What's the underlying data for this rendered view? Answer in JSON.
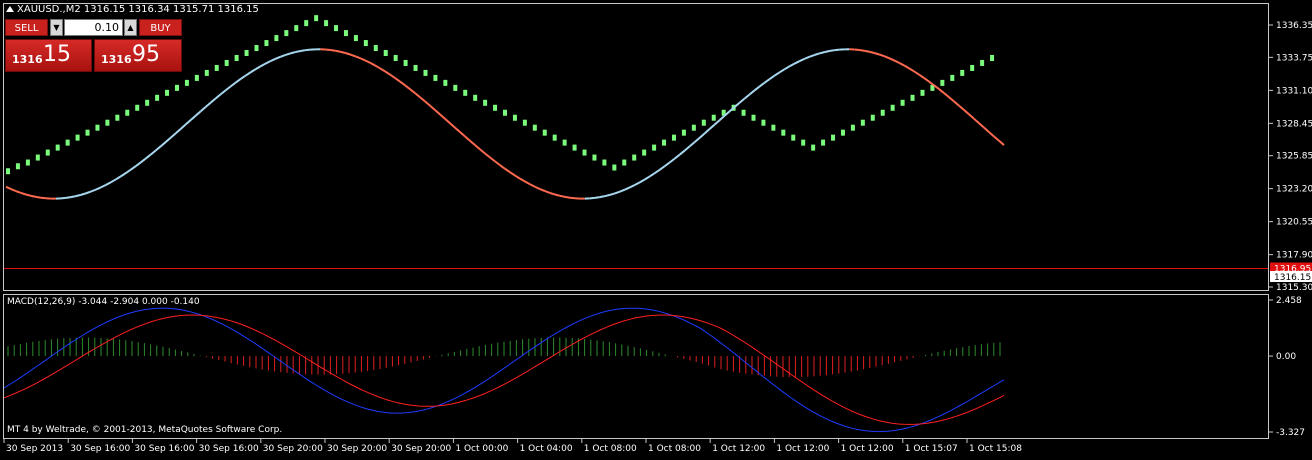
{
  "header": {
    "symbol_line": "XAUUSD.,M2  1316.15 1316.34 1315.71 1316.15",
    "collapse_icon": "triangle-up-icon"
  },
  "trade_panel": {
    "sell_label": "SELL",
    "buy_label": "BUY",
    "lot_value": "0.10",
    "sell_price_big": "1316",
    "sell_price_pips": "15",
    "buy_price_big": "1316",
    "buy_price_pips": "95",
    "colors": {
      "button_red": "#c9211e"
    }
  },
  "indicator": {
    "label": "MACD(12,26,9) -3.044 -2.904 0.000 -0.140"
  },
  "footer": {
    "copyright": "MT 4 by Weltrade, © 2001-2013, MetaQuotes Software Corp."
  },
  "chart_data": [
    {
      "type": "line",
      "title": "XAUUSD.,M2",
      "price_axis_ticks": [
        "1336.35",
        "1333.75",
        "1331.10",
        "1328.45",
        "1325.85",
        "1323.20",
        "1320.55",
        "1317.90",
        "1315.30"
      ],
      "ylim": [
        1315.3,
        1336.35
      ],
      "current_bid_label": "1316.15",
      "ask_label": "1316.95",
      "ask_line_value": 1316.95,
      "time_axis_labels": [
        "30 Sep 2013",
        "30 Sep 16:00",
        "30 Sep 16:00",
        "30 Sep 16:00",
        "30 Sep 20:00",
        "30 Sep 20:00",
        "30 Sep 20:00",
        "1 Oct 00:00",
        "1 Oct 04:00",
        "1 Oct 08:00",
        "1 Oct 08:00",
        "1 Oct 12:00",
        "1 Oct 12:00",
        "1 Oct 12:00",
        "1 Oct 15:07",
        "1 Oct 15:08"
      ],
      "series": [
        {
          "kind": "price_markers",
          "color": "#7cfc7c",
          "x": [
            0,
            2,
            4,
            6,
            8,
            10,
            12,
            14,
            16,
            18,
            20,
            22,
            24,
            26,
            28,
            30,
            32,
            34,
            36,
            38,
            40,
            42,
            44,
            46,
            48,
            50,
            52,
            54,
            56,
            58,
            60,
            62,
            64,
            66,
            68,
            70,
            72,
            74,
            76,
            78,
            80,
            82,
            84,
            86,
            88,
            90,
            92,
            94,
            96,
            98,
            100,
            102,
            104,
            106,
            108,
            110,
            112,
            114,
            116,
            118,
            120,
            122,
            124,
            126,
            128,
            130,
            132,
            134,
            136,
            138,
            140,
            142,
            144,
            146,
            148,
            150,
            152,
            154,
            156,
            158,
            160,
            162,
            164,
            166,
            168,
            170,
            172,
            174,
            176,
            178,
            180,
            182,
            184,
            186,
            188,
            190,
            192,
            194,
            196,
            198,
            200
          ],
          "y": [
            1324.6,
            1325.0,
            1325.3,
            1325.7,
            1326.1,
            1326.5,
            1326.9,
            1327.3,
            1327.7,
            1328.1,
            1328.5,
            1328.9,
            1329.3,
            1329.7,
            1330.1,
            1330.5,
            1330.9,
            1331.3,
            1331.7,
            1332.1,
            1332.5,
            1332.9,
            1333.3,
            1333.7,
            1334.1,
            1334.5,
            1334.9,
            1335.3,
            1335.7,
            1336.1,
            1336.5,
            1336.9,
            1336.5,
            1336.1,
            1335.7,
            1335.3,
            1334.9,
            1334.5,
            1334.1,
            1333.7,
            1333.3,
            1332.9,
            1332.5,
            1332.1,
            1331.7,
            1331.3,
            1330.9,
            1330.5,
            1330.1,
            1329.7,
            1329.3,
            1328.9,
            1328.5,
            1328.1,
            1327.7,
            1327.3,
            1326.9,
            1326.5,
            1326.1,
            1325.7,
            1325.3,
            1324.9,
            1325.3,
            1325.7,
            1326.1,
            1326.5,
            1326.9,
            1327.3,
            1327.7,
            1328.1,
            1328.5,
            1328.9,
            1329.3,
            1329.7,
            1329.3,
            1328.9,
            1328.5,
            1328.1,
            1327.7,
            1327.3,
            1326.9,
            1326.5,
            1326.9,
            1327.3,
            1327.7,
            1328.1,
            1328.5,
            1328.9,
            1329.3,
            1329.7,
            1330.1,
            1330.5,
            1330.9,
            1331.3,
            1331.7,
            1332.1,
            1332.5,
            1332.9,
            1333.3,
            1333.7,
            1334.1
          ]
        },
        {
          "kind": "trend_line_up",
          "color": "#a8d8f0",
          "x": [
            0,
            10,
            20,
            30,
            40,
            50,
            60,
            70,
            80,
            90,
            100
          ],
          "y": [
            1324.2,
            1322.4,
            1322.2,
            1323.6,
            1327.4,
            1331.4,
            1334.1,
            1334.0,
            1331.6,
            1329.0,
            1327.4
          ]
        }
      ]
    },
    {
      "type": "bar",
      "title": "MACD(12,26,9)",
      "ylim": [
        -3.327,
        2.458
      ],
      "axis_ticks": [
        "2.458",
        "0.00",
        "-3.327"
      ],
      "histogram_colors": {
        "positive": "#2e8b2e",
        "negative": "#e02020"
      },
      "lines": [
        {
          "name": "MACD",
          "color": "#1e3cff"
        },
        {
          "name": "Signal",
          "color": "#ff2020"
        }
      ]
    }
  ]
}
